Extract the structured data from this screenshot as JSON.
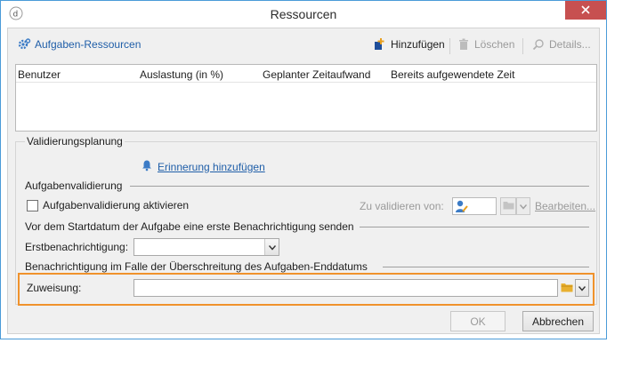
{
  "window": {
    "title": "Ressourcen"
  },
  "toolbar": {
    "task_resources": "Aufgaben-Ressourcen",
    "add": "Hinzufügen",
    "delete": "Löschen",
    "details": "Details..."
  },
  "table": {
    "columns": [
      "Benutzer",
      "Auslastung (in %)",
      "Geplanter Zeitaufwand",
      "Bereits aufgewendete Zeit"
    ],
    "rows": []
  },
  "validation": {
    "group_label": "Validierungsplanung",
    "add_reminder": "Erinnerung hinzufügen",
    "task_validation_title": "Aufgabenvalidierung",
    "enable_checkbox_label": "Aufgabenvalidierung aktivieren",
    "enable_checked": false,
    "validate_by_label": "Zu validieren von:",
    "edit_link": "Bearbeiten...",
    "first_notification_title": "Vor dem Startdatum der Aufgabe eine erste Benachrichtigung senden",
    "first_notification_label": "Erstbenachrichtigung:",
    "first_notification_value": "",
    "overdue_title": "Benachrichtigung im Falle der Überschreitung des Aufgaben-Enddatums",
    "assignment_label": "Zuweisung:",
    "assignment_value": ""
  },
  "buttons": {
    "ok": "OK",
    "cancel": "Abbrechen"
  },
  "colors": {
    "accent": "#1f5ea8",
    "highlight": "#f0922c",
    "close": "#c75050"
  }
}
